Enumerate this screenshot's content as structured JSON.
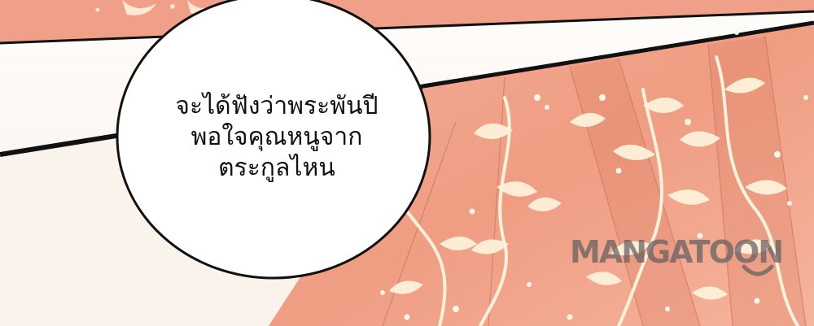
{
  "panel": {
    "speech_text": "จะได้ฟังว่าพระพันปี\nพอใจคุณหนูจาก\nตระกูลไหน",
    "watermark": "MANGATOON"
  },
  "colors": {
    "robe": "#f2a58c",
    "robe_deep": "#e98d74",
    "blossom": "#fff4df",
    "bubble": "#ffffff",
    "ink": "#111111",
    "page": "#fbf6f1"
  }
}
